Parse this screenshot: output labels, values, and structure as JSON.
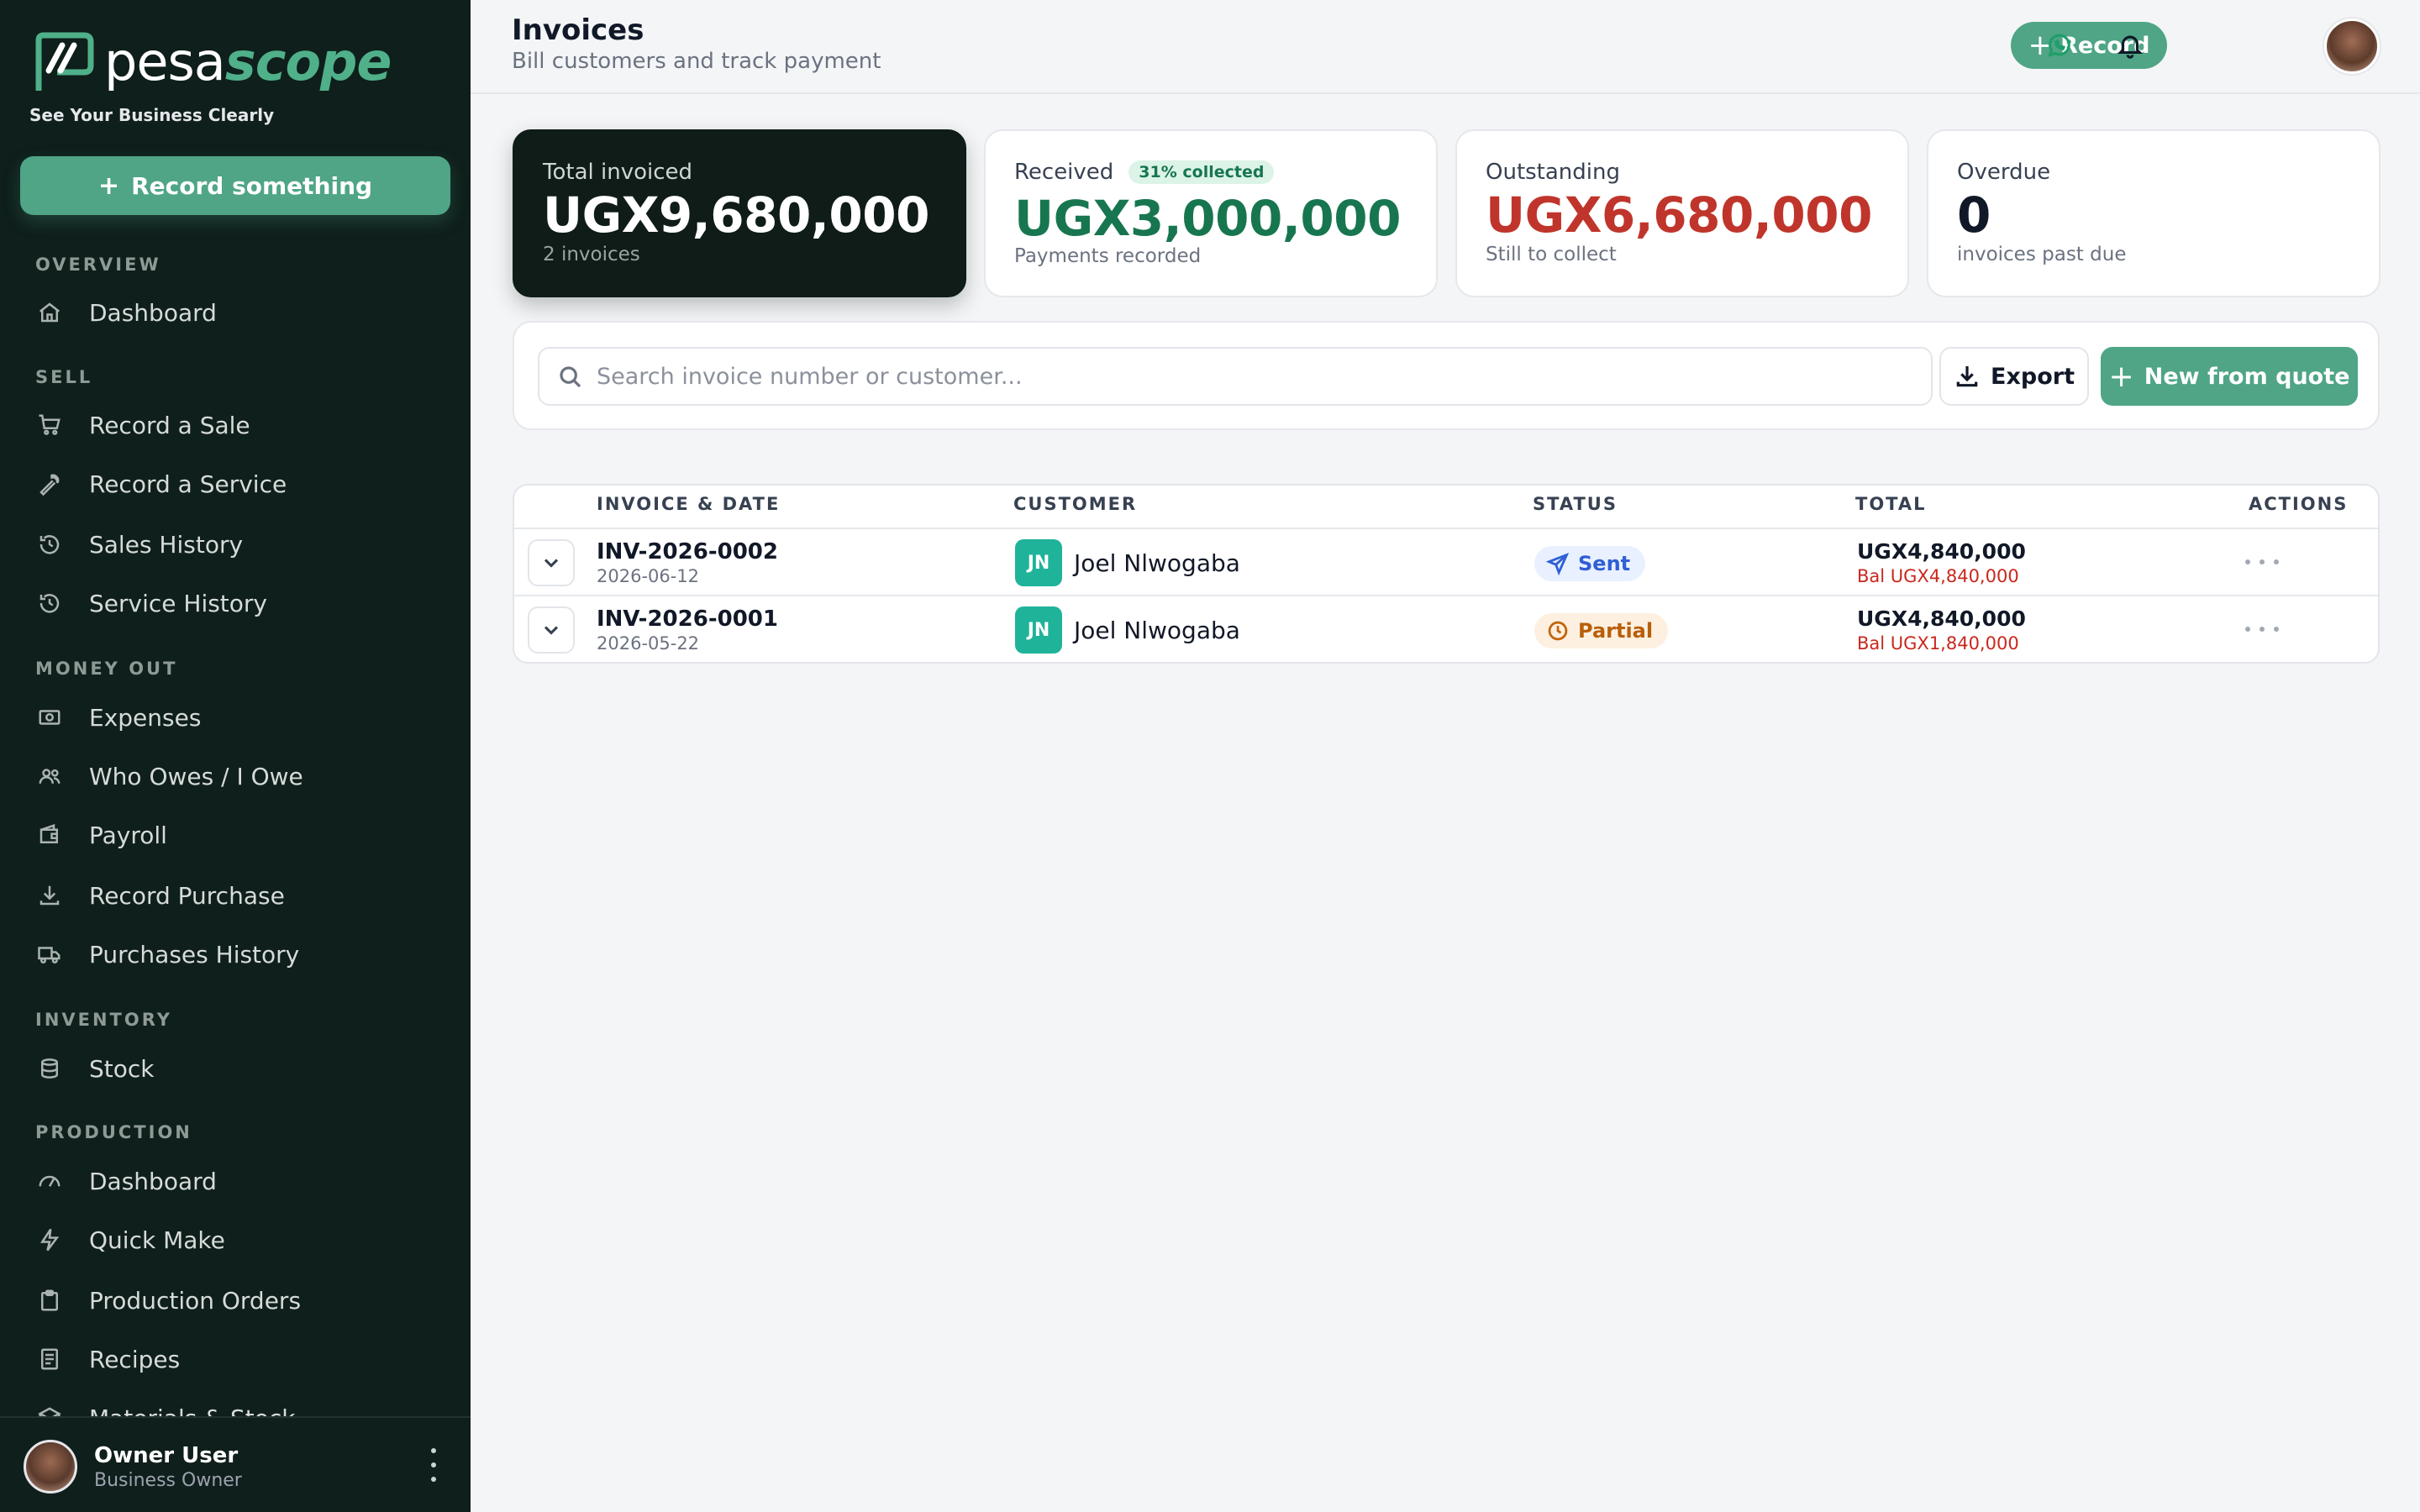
{
  "brand": {
    "name_part1": "pesa",
    "name_part2": "scope",
    "tagline": "See Your Business Clearly",
    "accent_color": "#4fa586",
    "sidebar_bg": "#0f1f1b"
  },
  "sidebar": {
    "record_button": "Record something",
    "sections": [
      {
        "title": "OVERVIEW"
      },
      {
        "title": "SELL"
      },
      {
        "title": "MONEY OUT"
      },
      {
        "title": "INVENTORY"
      },
      {
        "title": "PRODUCTION"
      }
    ],
    "items": [
      {
        "label": "Dashboard",
        "icon": "home-icon"
      },
      {
        "label": "Record a Sale",
        "icon": "cart-icon"
      },
      {
        "label": "Record a Service",
        "icon": "wrench-icon"
      },
      {
        "label": "Sales History",
        "icon": "history-icon"
      },
      {
        "label": "Service History",
        "icon": "history-icon"
      },
      {
        "label": "Expenses",
        "icon": "money-icon"
      },
      {
        "label": "Who Owes / I Owe",
        "icon": "users-icon"
      },
      {
        "label": "Payroll",
        "icon": "wallet-icon"
      },
      {
        "label": "Record Purchase",
        "icon": "download-icon"
      },
      {
        "label": "Purchases History",
        "icon": "truck-icon"
      },
      {
        "label": "Stock",
        "icon": "database-icon"
      },
      {
        "label": "Dashboard",
        "icon": "gauge-icon"
      },
      {
        "label": "Quick Make",
        "icon": "bolt-icon"
      },
      {
        "label": "Production Orders",
        "icon": "clipboard-icon"
      },
      {
        "label": "Recipes",
        "icon": "document-icon"
      },
      {
        "label": "Materials & Stock",
        "icon": "box-icon"
      }
    ],
    "user": {
      "name": "Owner User",
      "role": "Business Owner"
    }
  },
  "header": {
    "title": "Invoices",
    "subtitle": "Bill customers and track payment",
    "record_button": "Record"
  },
  "stats": {
    "total_invoiced": {
      "label": "Total invoiced",
      "value": "UGX9,680,000",
      "sub": "2 invoices"
    },
    "received": {
      "label": "Received",
      "badge": "31% collected",
      "value": "UGX3,000,000",
      "sub": "Payments recorded",
      "color": "#17764f"
    },
    "outstanding": {
      "label": "Outstanding",
      "value": "UGX6,680,000",
      "sub": "Still to collect",
      "color": "#c0352b"
    },
    "overdue": {
      "label": "Overdue",
      "value": "0",
      "sub": "invoices past due"
    }
  },
  "toolbar": {
    "search_placeholder": "Search invoice number or customer...",
    "export_label": "Export",
    "new_from_quote_label": "New from quote"
  },
  "table": {
    "columns": [
      "INVOICE & DATE",
      "CUSTOMER",
      "STATUS",
      "TOTAL",
      "ACTIONS"
    ],
    "rows": [
      {
        "invoice": "INV-2026-0002",
        "date": "2026-06-12",
        "initials": "JN",
        "customer": "Joel Nlwogaba",
        "status": "Sent",
        "total": "UGX4,840,000",
        "balance": "Bal UGX4,840,000"
      },
      {
        "invoice": "INV-2026-0001",
        "date": "2026-05-22",
        "initials": "JN",
        "customer": "Joel Nlwogaba",
        "status": "Partial",
        "total": "UGX4,840,000",
        "balance": "Bal UGX1,840,000"
      }
    ]
  }
}
